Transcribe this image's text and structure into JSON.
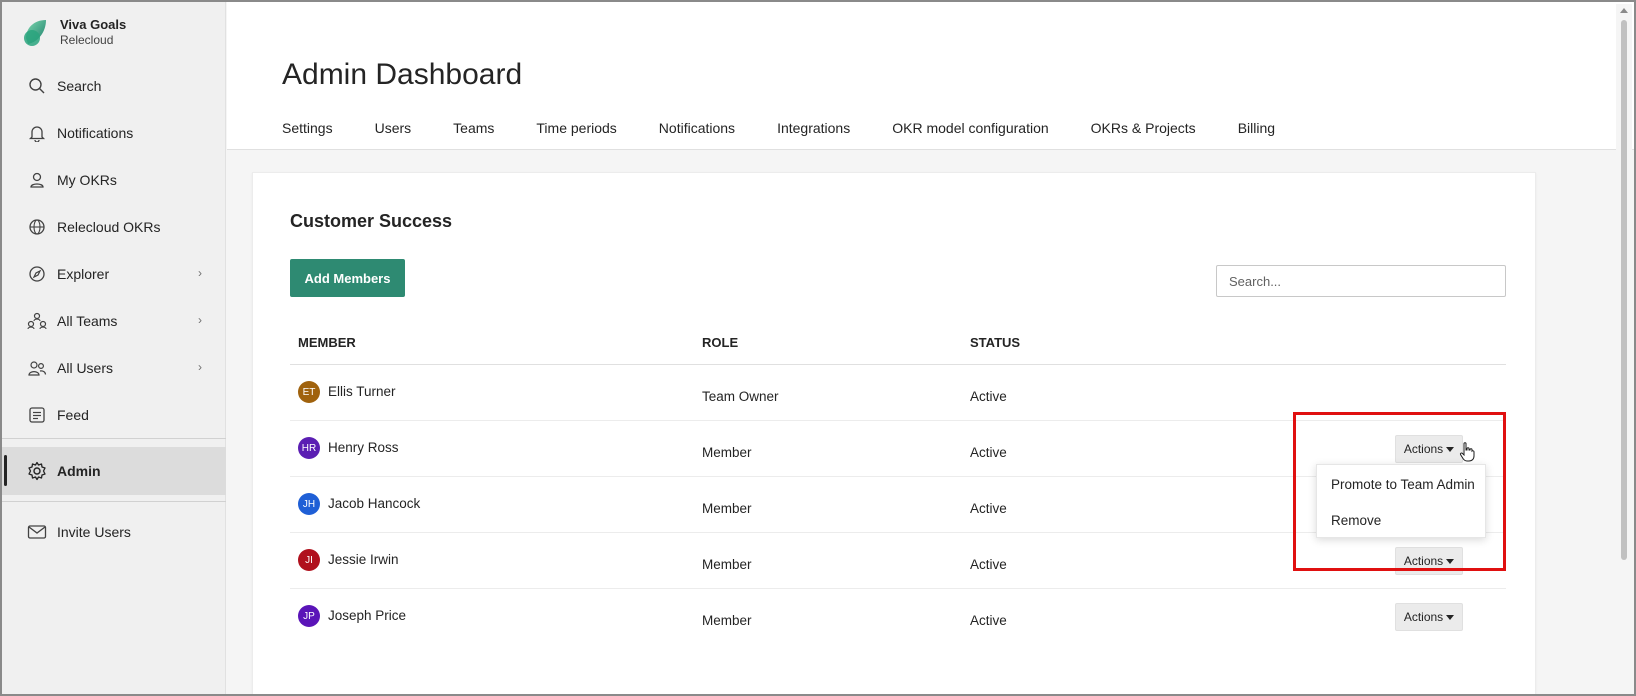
{
  "brand": {
    "name": "Viva Goals",
    "org": "Relecloud"
  },
  "sidebar": {
    "items": [
      {
        "label": "Search",
        "icon": "search-icon"
      },
      {
        "label": "Notifications",
        "icon": "bell-icon"
      },
      {
        "label": "My OKRs",
        "icon": "person-icon"
      },
      {
        "label": "Relecloud OKRs",
        "icon": "globe-icon"
      },
      {
        "label": "Explorer",
        "icon": "compass-icon"
      },
      {
        "label": "All Teams",
        "icon": "teams-icon"
      },
      {
        "label": "All Users",
        "icon": "users-icon"
      },
      {
        "label": "Feed",
        "icon": "feed-icon"
      },
      {
        "label": "Admin",
        "icon": "gear-icon"
      },
      {
        "label": "Invite Users",
        "icon": "mail-icon"
      }
    ]
  },
  "header": {
    "title": "Admin Dashboard",
    "tabs": [
      "Settings",
      "Users",
      "Teams",
      "Time periods",
      "Notifications",
      "Integrations",
      "OKR model configuration",
      "OKRs & Projects",
      "Billing"
    ]
  },
  "team": {
    "title": "Customer Success",
    "add_button": "Add Members",
    "search_placeholder": "Search..."
  },
  "table": {
    "headers": {
      "member": "MEMBER",
      "role": "ROLE",
      "status": "STATUS"
    },
    "rows": [
      {
        "initials": "ET",
        "name": "Ellis Turner",
        "role": "Team Owner",
        "status": "Active",
        "avatar_color": "#a0620d",
        "actions": ""
      },
      {
        "initials": "HR",
        "name": "Henry Ross",
        "role": "Member",
        "status": "Active",
        "avatar_color": "#5b1eb3",
        "actions": "Actions"
      },
      {
        "initials": "JH",
        "name": "Jacob Hancock",
        "role": "Member",
        "status": "Active",
        "avatar_color": "#1f5fd6",
        "actions": ""
      },
      {
        "initials": "JI",
        "name": "Jessie Irwin",
        "role": "Member",
        "status": "Active",
        "avatar_color": "#b0101d",
        "actions": "Actions"
      },
      {
        "initials": "JP",
        "name": "Joseph Price",
        "role": "Member",
        "status": "Active",
        "avatar_color": "#5a14b8",
        "actions": "Actions"
      }
    ]
  },
  "dropdown": {
    "items": [
      "Promote to Team Admin",
      "Remove"
    ]
  },
  "colors": {
    "accent": "#2e8a72",
    "highlight": "#e01010"
  }
}
